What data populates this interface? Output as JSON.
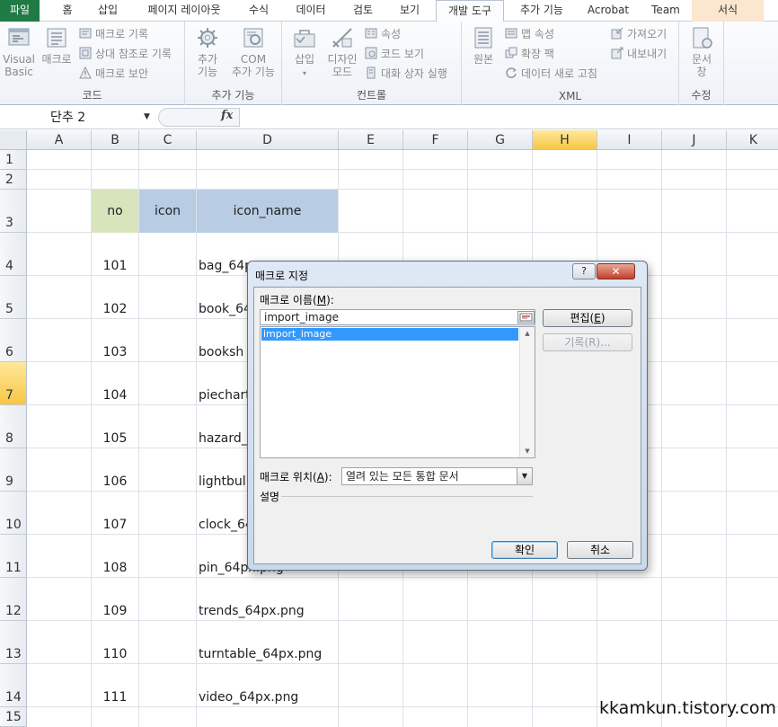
{
  "ribbon_tabs": [
    {
      "label": "파일"
    },
    {
      "label": "홈"
    },
    {
      "label": "삽입"
    },
    {
      "label": "페이지 레이아웃"
    },
    {
      "label": "수식"
    },
    {
      "label": "데이터"
    },
    {
      "label": "검토"
    },
    {
      "label": "보기"
    },
    {
      "label": "개발 도구"
    },
    {
      "label": "추가 기능"
    },
    {
      "label": "Acrobat"
    },
    {
      "label": "Team"
    },
    {
      "label": "서식"
    }
  ],
  "ribbon": {
    "code_group": {
      "label": "코드",
      "visual_basic_line1": "Visual",
      "visual_basic_line2": "Basic",
      "macro": "매크로",
      "record_macro": "매크로 기록",
      "relative_ref": "상대 참조로 기록",
      "macro_security": "매크로 보안"
    },
    "addins_group": {
      "label": "추가 기능",
      "addins_line1": "추가",
      "addins_line2": "기능",
      "com_line1": "COM",
      "com_line2": "추가 기능"
    },
    "controls_group": {
      "label": "컨트롤",
      "insert": "삽입",
      "design_line1": "디자인",
      "design_line2": "모드",
      "properties": "속성",
      "view_code": "코드 보기",
      "run_dialog": "대화 상자 실행"
    },
    "xml_group": {
      "label": "XML",
      "source": "원본",
      "map_properties": "맵 속성",
      "expansion_packs": "확장 팩",
      "refresh_data": "데이터 새로 고침",
      "import": "가져오기",
      "export": "내보내기"
    },
    "modify_group": {
      "label": "수정",
      "doc_panel_line1": "문서",
      "doc_panel_line2": "창"
    }
  },
  "formula_bar": {
    "name_box": "단추 2",
    "fx": "fx",
    "formula": ""
  },
  "columns": [
    "A",
    "B",
    "C",
    "D",
    "E",
    "F",
    "G",
    "H",
    "I",
    "J",
    "K"
  ],
  "selected_column": "H",
  "rows": [
    "1",
    "2",
    "3",
    "4",
    "5",
    "6",
    "7",
    "8",
    "9",
    "10",
    "11",
    "12",
    "13",
    "14",
    "15"
  ],
  "selected_row": "7",
  "table_headers": {
    "no": "no",
    "icon": "icon",
    "icon_name": "icon_name"
  },
  "table_rows": [
    {
      "no": "101",
      "name": "bag_64p"
    },
    {
      "no": "102",
      "name": "book_64"
    },
    {
      "no": "103",
      "name": "booksh"
    },
    {
      "no": "104",
      "name": "piechart"
    },
    {
      "no": "105",
      "name": "hazard_"
    },
    {
      "no": "106",
      "name": "lightbul"
    },
    {
      "no": "107",
      "name": "clock_64"
    },
    {
      "no": "108",
      "name": "pin_64px.png"
    },
    {
      "no": "109",
      "name": "trends_64px.png"
    },
    {
      "no": "110",
      "name": "turntable_64px.png"
    },
    {
      "no": "111",
      "name": "video_64px.png"
    }
  ],
  "dialog": {
    "title": "매크로 지정",
    "help": "?",
    "close": "✕",
    "macro_name_label": "매크로 이름(",
    "macro_name_key": "M",
    "macro_name_label_end": "):",
    "macro_name_value": "import_image",
    "macro_list": [
      "import_image"
    ],
    "edit_button": "편집(",
    "edit_key": "E",
    "edit_end": ")",
    "record_button": "기록(R)...",
    "location_label": "매크로 위치(",
    "location_key": "A",
    "location_end": "):",
    "location_value": "열려 있는 모든 통합 문서",
    "description_label": "설명",
    "ok_button": "확인",
    "cancel_button": "취소"
  },
  "watermark": "kkamkun.tistory.com",
  "colors": {
    "file_tab": "#1f7a44",
    "no_header_bg": "#d8e4bc",
    "icon_header_bg": "#b8cce4",
    "selection_highlight": "#3399ff",
    "selected_header": "#f7c645"
  }
}
